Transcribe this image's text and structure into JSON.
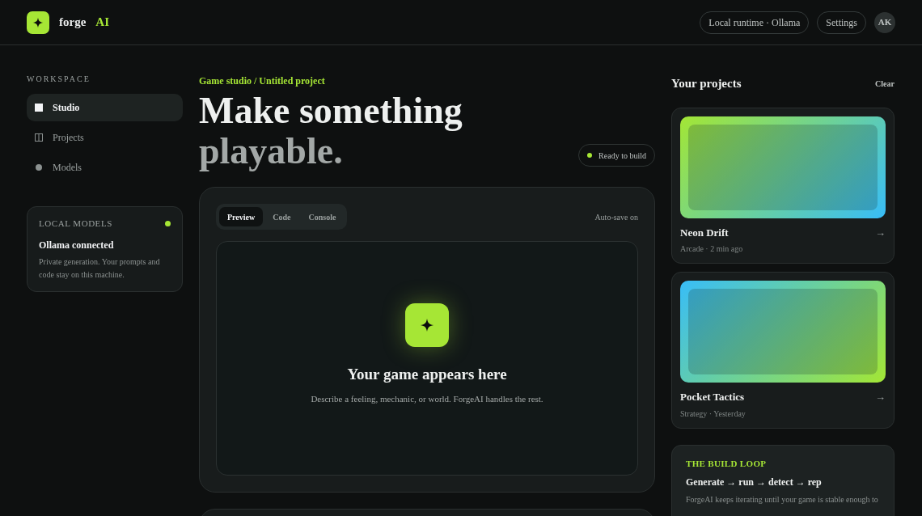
{
  "header": {
    "logo_text": "forge",
    "logo_accent": "AI",
    "runtime": "Local runtime · Ollama",
    "settings": "Settings",
    "avatar": "AK"
  },
  "sidebar": {
    "heading": "WORKSPACE",
    "items": [
      {
        "label": "Studio",
        "kind": "square",
        "selected": true
      },
      {
        "label": "Projects",
        "kind": "columns",
        "selected": false
      },
      {
        "label": "Models",
        "kind": "dot",
        "selected": false
      }
    ],
    "status_card": {
      "title": "LOCAL MODELS",
      "online": true,
      "headline": "Ollama connected",
      "text": "Private generation. Your prompts and code stay on this machine."
    }
  },
  "main": {
    "breadcrumb": "Game studio / Untitled project",
    "title_line_1": "Make something",
    "title_line_2": "playable.",
    "status": {
      "label": "Ready to build",
      "ready": true
    },
    "tabs": [
      {
        "label": "Preview",
        "selected": true
      },
      {
        "label": "Code",
        "selected": false
      },
      {
        "label": "Console",
        "selected": false
      }
    ],
    "autosave": "Auto-save on",
    "preview": {
      "title": "Your game appears here",
      "text": "Describe a feeling, mechanic, or world. ForgeAI handles the rest."
    }
  },
  "projects": {
    "title": "Your projects",
    "clear": "Clear",
    "items": [
      {
        "name": "Neon Drift",
        "meta": "Arcade · 2 min ago",
        "arrow": "→",
        "kind": "lime"
      },
      {
        "name": "Pocket Tactics",
        "meta": "Strategy · Yesterday",
        "arrow": "→",
        "kind": "sky"
      }
    ],
    "loop": {
      "heading": "THE BUILD LOOP",
      "steps": "Generate → run → detect → rep",
      "text": "ForgeAI keeps iterating until your game is stable enough to"
    }
  }
}
